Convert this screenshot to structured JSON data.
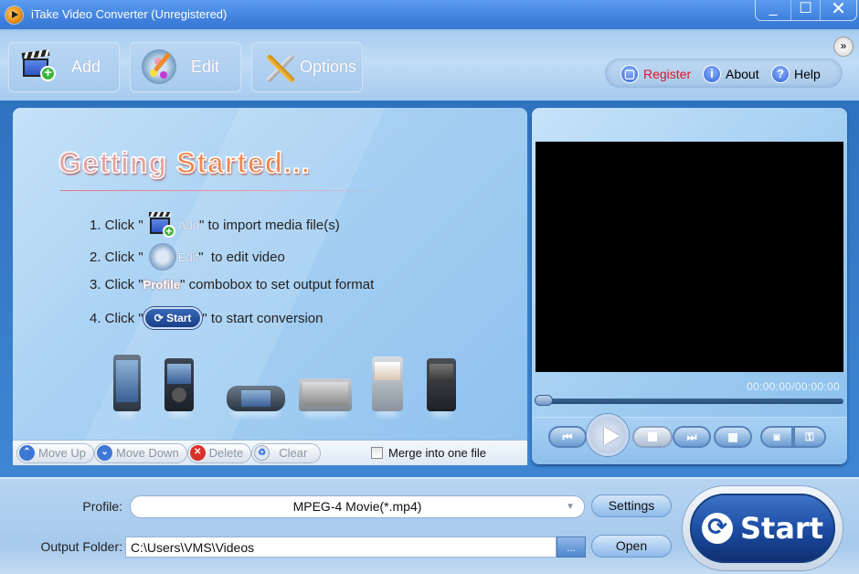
{
  "window": {
    "title": "iTake Video Converter (Unregistered)",
    "controls": {
      "minimize": "_",
      "maximize": "☐",
      "close": "✕"
    }
  },
  "toolbar": {
    "buttons": [
      {
        "label": "Add",
        "icon": "add-media-icon"
      },
      {
        "label": "Edit",
        "icon": "edit-palette-icon"
      },
      {
        "label": "Options",
        "icon": "options-tools-icon"
      }
    ],
    "more": "»",
    "help_links": [
      {
        "label": "Register",
        "icon": "lock-icon",
        "glyph": "🔒",
        "color": "#e0102a"
      },
      {
        "label": "About",
        "icon": "info-icon",
        "glyph": "i",
        "color": "#111111"
      },
      {
        "label": "Help",
        "icon": "help-icon",
        "glyph": "?",
        "color": "#111111"
      }
    ]
  },
  "getting_started": {
    "title_part1": "Getting",
    "title_part2": "Started...",
    "steps": [
      {
        "prefix": "1. Click \" ",
        "inline": "Add",
        "suffix": "\" to import media file(s)"
      },
      {
        "prefix": "2. Click \" ",
        "inline": "Edit",
        "suffix": "\"  to edit video"
      },
      {
        "prefix": "3. Click \"",
        "inline": "Profile",
        "suffix": "\" combobox to set output format"
      },
      {
        "prefix": "4. Click \"",
        "inline": "Start",
        "suffix": "\" to start conversion"
      }
    ],
    "devices": [
      "iPhone",
      "iPod",
      "PSP",
      "Media Player",
      "Smartphone",
      "BlackBerry"
    ]
  },
  "list_toolbar": {
    "buttons": [
      {
        "label": "Move Up",
        "icon": "move-up-icon",
        "glyph": "⌃",
        "color": "#3d78d6"
      },
      {
        "label": "Move Down",
        "icon": "move-down-icon",
        "glyph": "⌄",
        "color": "#3d78d6"
      },
      {
        "label": "Delete",
        "icon": "delete-icon",
        "glyph": "✕",
        "color": "#d8322a"
      },
      {
        "label": "Clear",
        "icon": "clear-icon",
        "glyph": "♻",
        "color": "#6b8fb8"
      }
    ],
    "merge_label": "Merge into one file",
    "merge_checked": false
  },
  "player": {
    "time": "00:00:00/00:00:00",
    "progress": 0,
    "controls": [
      "previous",
      "play",
      "stop",
      "next",
      "fullscreen",
      "snapshot",
      "settings"
    ]
  },
  "bottom": {
    "profile_label": "Profile:",
    "profile_value": "MPEG-4 Movie(*.mp4)",
    "settings_button": "Settings",
    "output_label": "Output Folder:",
    "output_value": "C:\\Users\\VMS\\Videos",
    "browse_button": "...",
    "open_button": "Open",
    "start_button": "Start"
  }
}
